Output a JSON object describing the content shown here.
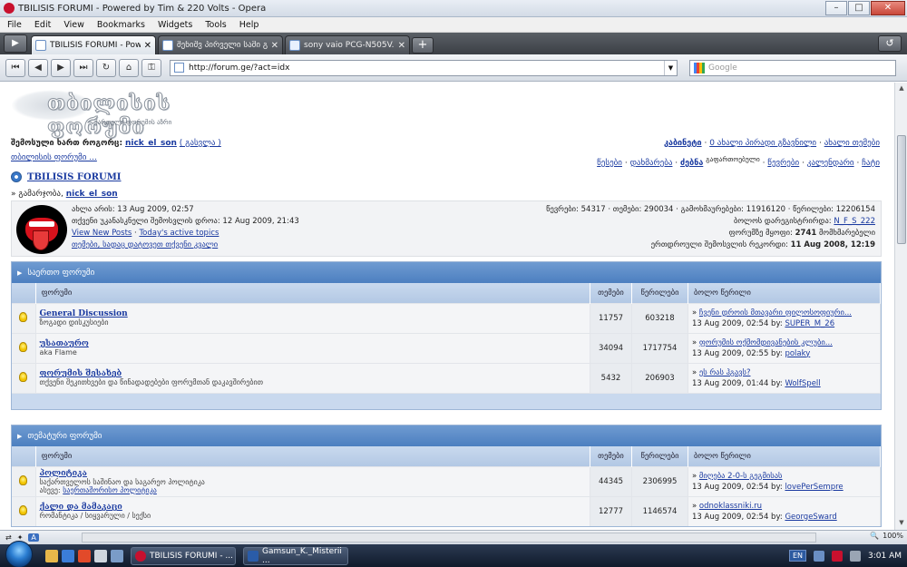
{
  "window": {
    "title": "TBILISIS FORUMI - Powered by Tim & 220 Volts - Opera"
  },
  "menu": [
    "File",
    "Edit",
    "View",
    "Bookmarks",
    "Widgets",
    "Tools",
    "Help"
  ],
  "tabs": [
    {
      "label": "TBILISIS FORUMI - Pow...",
      "active": true
    },
    {
      "label": "შენიშვ პირველი სამი გ...",
      "active": false
    },
    {
      "label": "sony vaio PCG-N505V...",
      "active": false
    }
  ],
  "address": {
    "url": "http://forum.ge/?act=idx",
    "search_placeholder": "Google"
  },
  "logo": {
    "title": "თბილისის ფორუმი",
    "subtitle": "ქართული ფორუმის აზრი"
  },
  "user": {
    "logged_as_label": "შემოსული ხართ როგორც:",
    "username": "nick_el_son",
    "logout_label": "( გასვლა )",
    "old_forums": "თბილისის ფორუმი ..."
  },
  "toplinks": {
    "row1": [
      "კაბინეტი",
      "0 ახალი პირადი გზავნილი",
      "ახალი თემები"
    ],
    "row2": [
      "წესები",
      "დახმარება",
      "ძებნა",
      "წევრები",
      "კალენდარი",
      "ჩატი"
    ],
    "search_extra": "გაფართოებული"
  },
  "forum": {
    "name": "TBILISIS FORUMI",
    "welcome_label": "» გამარჯობა,",
    "welcome_user": "nick_el_son"
  },
  "stats": {
    "left": {
      "now": "ახლა არის: 13 Aug 2009, 02:57",
      "last_visit": "თქვენი უკანასკნელი შემოსვლის დროა: 12 Aug 2009, 21:43",
      "view_new": "View New Posts",
      "active_today": "Today's active topics",
      "my_topics": "თემები, სადაც დატოვეთ თქვენი კვალი"
    },
    "right": {
      "totals": "წევრები: 54317 · თემები: 290034 · გამოხმაურებები: 11916120 · წერილები: 12206154",
      "newest_label": "ბოლოს დარეგისტრირდა:",
      "newest_user": "N_F_S_222",
      "online_label": "ფორუმზე მყოფი:",
      "online_count": "2741",
      "online_suffix": "მომხმარებელი",
      "record_label": "ერთდროული შემოსვლის რეკორდი:",
      "record_date": "11 Aug 2008, 12:19"
    }
  },
  "columns": {
    "forum": "ფორუმი",
    "topics": "თემები",
    "posts": "წერილები",
    "last": "ბოლო წერილი"
  },
  "categories": [
    {
      "title": "საერთო ფორუმი",
      "forums": [
        {
          "name": "General Discussion",
          "desc": "ზოგადი დისკუსიები",
          "topics": "11757",
          "posts": "603218",
          "last_title": "ჩვენი დროის მთავარი ფილოსოფიური...",
          "last_date": "13 Aug 2009, 02:54 by:",
          "last_user": "SUPER_M_26"
        },
        {
          "name": "უსათაურო",
          "desc": "aka Flame",
          "topics": "34094",
          "posts": "1717754",
          "last_title": "ფორუმის ოქმომდივანების კლუბი...",
          "last_date": "13 Aug 2009, 02:55 by:",
          "last_user": "polaky"
        },
        {
          "name": "ფორუმის შესახებ",
          "desc": "თქვენი შეკითხვები და წინადადებები ფორუმთან დაკავშირებით",
          "topics": "5432",
          "posts": "206903",
          "last_title": "ეს რას ჰგავს?",
          "last_date": "13 Aug 2009, 01:44 by:",
          "last_user": "WolfSpell"
        }
      ]
    },
    {
      "title": "თემატური ფორუმი",
      "forums": [
        {
          "name": "პოლიტიკა",
          "desc": "საქართველოს საშინაო და საგარეო პოლიტიკა",
          "sub_label": "ასევე:",
          "sub_link": "საერთაშორისო პოლიტიკა",
          "topics": "44345",
          "posts": "2306995",
          "last_title": "მიღება 2-0-ს გეგმისას",
          "last_date": "13 Aug 2009, 02:54 by:",
          "last_user": "lovePerSempre"
        },
        {
          "name": "ქალი და მამაკაცი",
          "desc": "რომანტიკა / სიყვარული / სექსი",
          "topics": "12777",
          "posts": "1146574",
          "last_title": "odnoklassniki.ru",
          "last_date": "13 Aug 2009, 02:54 by:",
          "last_user": "GeorgeSward"
        }
      ]
    }
  ],
  "statusbar": {
    "zoom": "100%"
  },
  "taskbar": {
    "items": [
      "TBILISIS FORUMI - ...",
      "Gamsun_K._Misterii ..."
    ],
    "lang": "EN",
    "time": "3:01 AM"
  }
}
